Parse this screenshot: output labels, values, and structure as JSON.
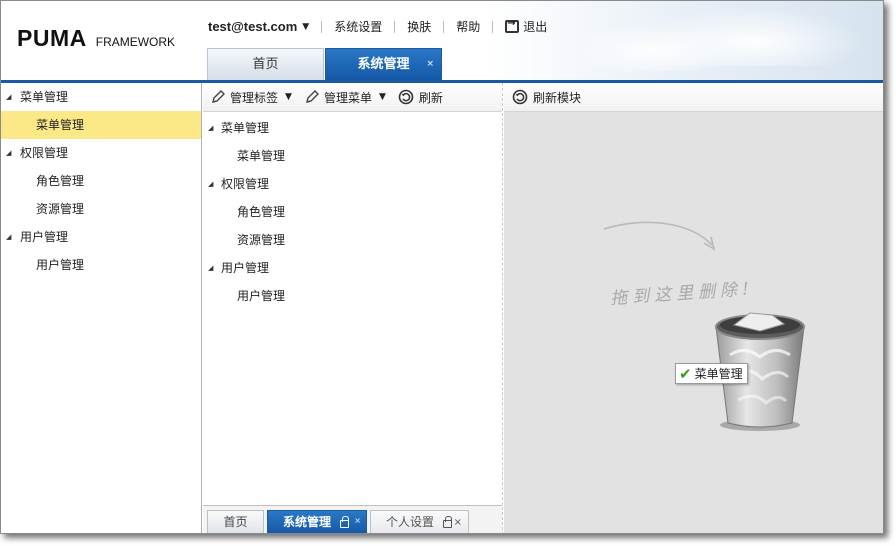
{
  "header": {
    "brand": "PUMA",
    "brand_sub": "FRAMEWORK",
    "user": "test@test.com",
    "nav": [
      "系统设置",
      "换肤",
      "帮助"
    ],
    "logout": "退出"
  },
  "main_tabs": [
    {
      "label": "首页"
    },
    {
      "label": "系统管理",
      "close": "×"
    }
  ],
  "sidebar": {
    "groups": [
      {
        "label": "菜单管理",
        "items": [
          "菜单管理"
        ]
      },
      {
        "label": "权限管理",
        "items": [
          "角色管理",
          "资源管理"
        ]
      },
      {
        "label": "用户管理",
        "items": [
          "用户管理"
        ]
      }
    ]
  },
  "mid_toolbar": {
    "tag_manage": "管理标签",
    "menu_manage": "管理菜单",
    "refresh": "刷新"
  },
  "mid_tree": {
    "groups": [
      {
        "label": "菜单管理",
        "items": [
          "菜单管理"
        ]
      },
      {
        "label": "权限管理",
        "items": [
          "角色管理",
          "资源管理"
        ]
      },
      {
        "label": "用户管理",
        "items": [
          "用户管理"
        ]
      }
    ]
  },
  "bottom_tabs": [
    {
      "label": "首页"
    },
    {
      "label": "系统管理",
      "close": "×"
    },
    {
      "label": "个人设置",
      "close": "×"
    }
  ],
  "right_toolbar": {
    "refresh_module": "刷新模块"
  },
  "trash": {
    "hint": "拖到这里删除!",
    "drag_item": "菜单管理"
  },
  "colors": {
    "accent_blue": "#1a5aa0",
    "selected_bg": "#fbe988",
    "trash_bg": "#e2e2e2"
  }
}
